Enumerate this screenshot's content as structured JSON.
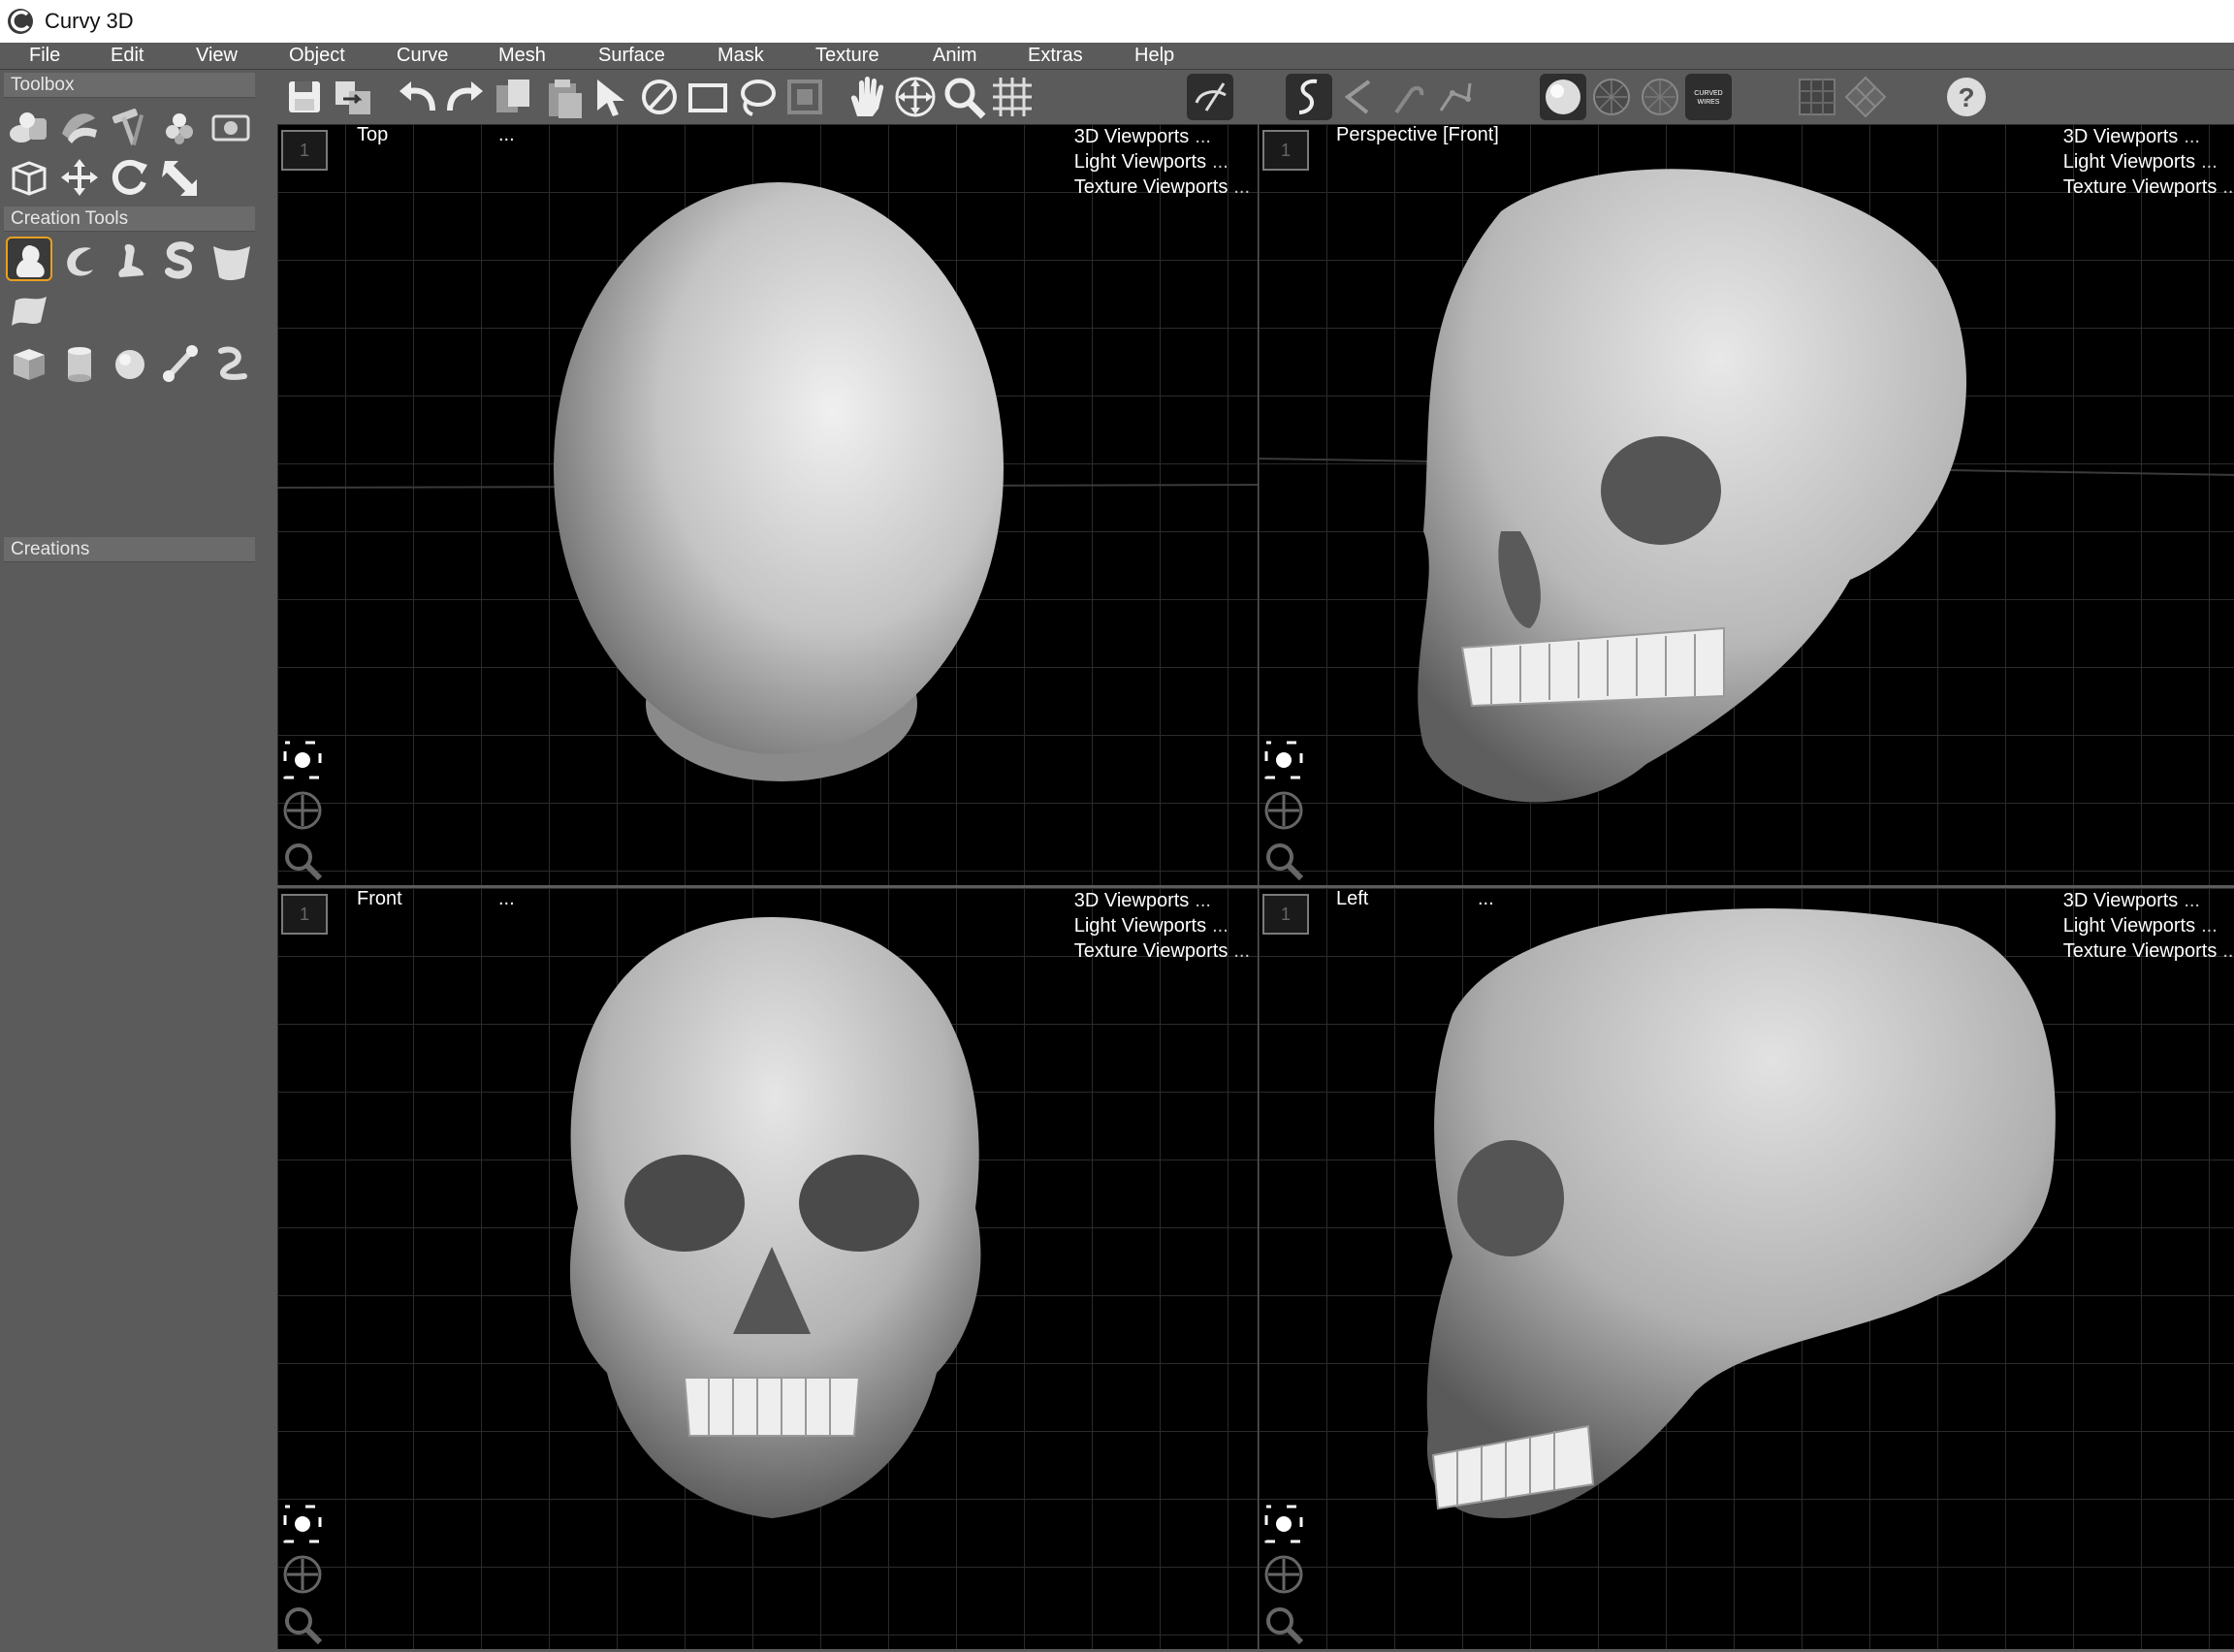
{
  "app": {
    "title": "Curvy 3D"
  },
  "menu": [
    "File",
    "Edit",
    "View",
    "Object",
    "Curve",
    "Mesh",
    "Surface",
    "Mask",
    "Texture",
    "Anim",
    "Extras",
    "Help"
  ],
  "sidebar": {
    "toolbox_label": "Toolbox",
    "creation_tools_label": "Creation Tools",
    "creations_label": "Creations",
    "toolbox_icons": [
      "objects-icon",
      "ribbon-icon",
      "hammer-icon",
      "spheres-icon",
      "camera-icon",
      "cube-box-icon",
      "move-icon",
      "rotate-icon",
      "scale-icon"
    ],
    "creation_icons": [
      "blob-shape-icon",
      "curl-shape-icon",
      "leg-shape-icon",
      "s-shape-icon",
      "bucket-shape-icon",
      "sheet-shape-icon",
      "cube-icon",
      "cylinder-icon",
      "sphere-icon",
      "bone-icon",
      "tube-icon"
    ]
  },
  "toolbar": {
    "icons": [
      "save-icon",
      "export-icon",
      "undo-icon",
      "redo-icon",
      "copy-icon",
      "paste-icon",
      "select-arrow-icon",
      "deselect-icon",
      "rect-select-icon",
      "lasso-select-icon",
      "mask-select-icon",
      "pan-hand-icon",
      "move-view-icon",
      "zoom-icon",
      "grid-icon",
      "snap-icon",
      "curve-draw-icon",
      "curve-open-icon",
      "curve-hook-icon",
      "curve-edit-icon",
      "shaded-sphere-icon",
      "wireframe-sphere-icon",
      "wire-sphere-icon",
      "curved-wires-icon",
      "flat-view-icon",
      "diamond-view-icon",
      "help-icon"
    ],
    "curved_wires_label": "CURVED WIRES"
  },
  "viewports": [
    {
      "name": "Top",
      "dots": "...",
      "num": "1"
    },
    {
      "name": "Perspective [Front]",
      "dots": "",
      "num": "1"
    },
    {
      "name": "Front",
      "dots": "...",
      "num": "1"
    },
    {
      "name": "Left",
      "dots": "...",
      "num": "1"
    }
  ],
  "viewport_links": {
    "link1": "3D Viewports",
    "link2": "Light Viewports",
    "link3": "Texture Viewports",
    "more": "..."
  },
  "colors": {
    "accent": "#e8a020",
    "bg": "#5b5b5b",
    "viewport": "#000000"
  }
}
